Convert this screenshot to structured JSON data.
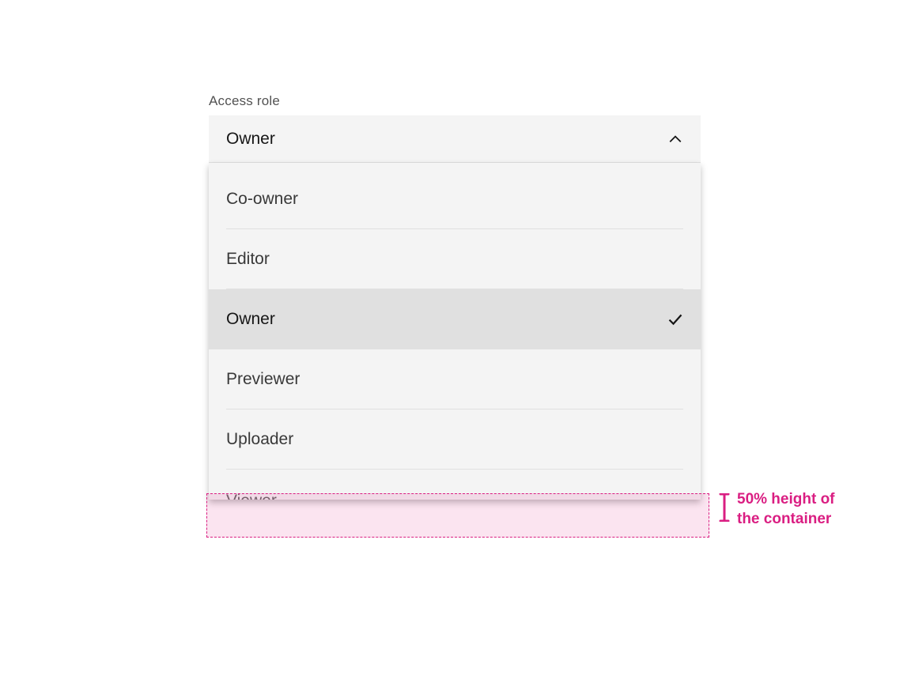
{
  "field": {
    "label": "Access role",
    "selected_value": "Owner"
  },
  "options": [
    {
      "label": "Co-owner",
      "selected": false
    },
    {
      "label": "Editor",
      "selected": false
    },
    {
      "label": "Owner",
      "selected": true
    },
    {
      "label": "Previewer",
      "selected": false
    },
    {
      "label": "Uploader",
      "selected": false
    },
    {
      "label": "Viewer",
      "selected": false
    }
  ],
  "annotation": {
    "text_line1": "50% height of",
    "text_line2": "the container"
  },
  "colors": {
    "annotation": "#da1e82",
    "menu_bg": "#f4f4f4",
    "selected_bg": "#e0e0e0"
  }
}
